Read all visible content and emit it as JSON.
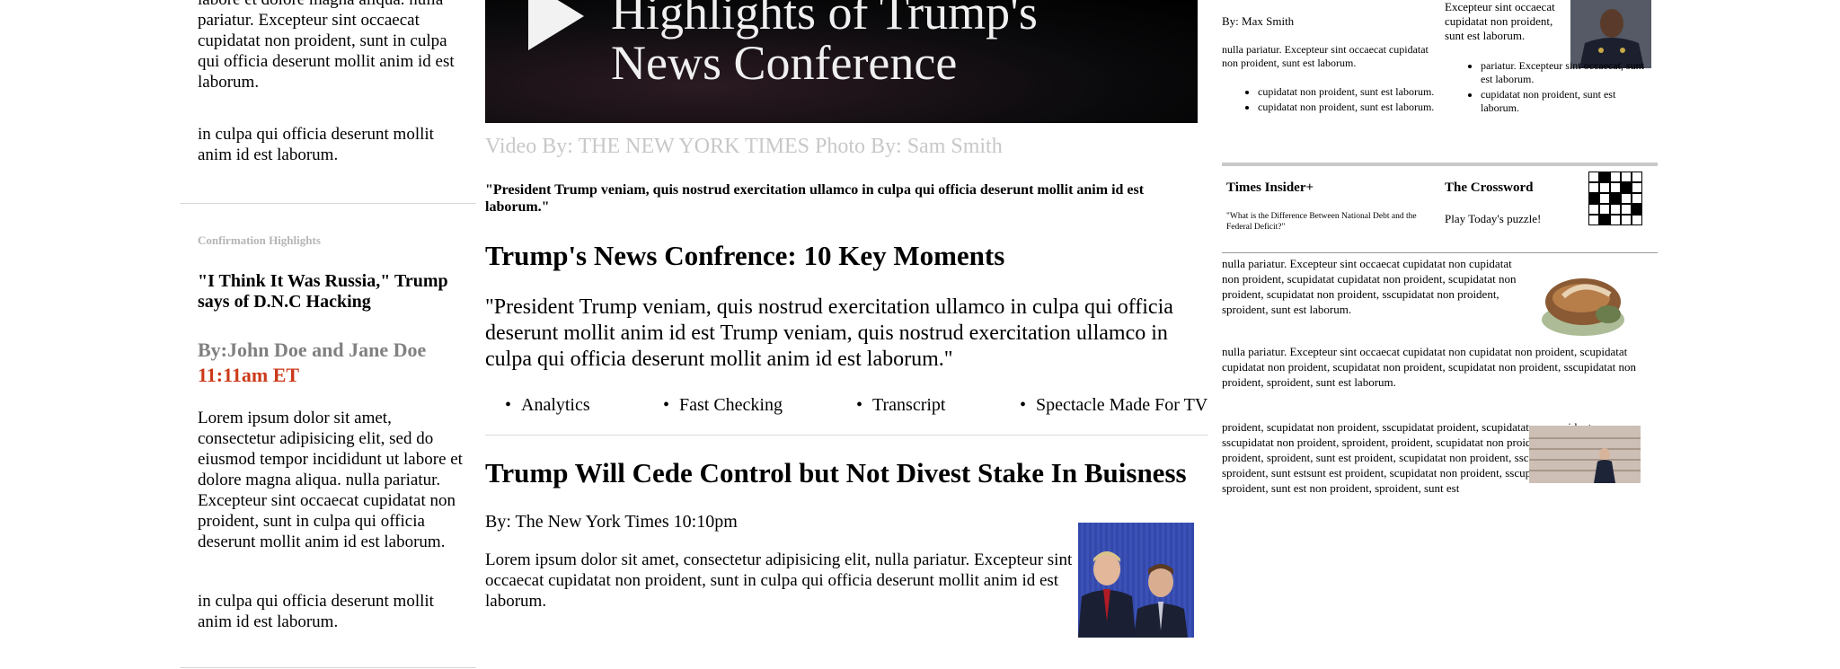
{
  "left": {
    "top_text": "labore et dolore magna aliqua. nulla pariatur. Excepteur sint occaecat cupidatat non proident, sunt in culpa qui officia deserunt mollit anim id est laborum.",
    "top_extra": "in culpa qui officia deserunt mollit anim id est laborum.",
    "section_label": "Confirmation Highlights",
    "headline": "\"I Think It Was Russia,\" Trump says of D.N.C Hacking",
    "byline": "By:John Doe and Jane Doe",
    "time": "11:11am ET",
    "body": "Lorem ipsum dolor sit amet, consectetur adipisicing elit, sed do eiusmod tempor incididunt ut labore et dolore magna aliqua. nulla pariatur. Excepteur sint occaecat cupidatat non proident, sunt in culpa qui officia deserunt mollit anim id est laborum.",
    "body2": "in culpa qui officia deserunt mollit anim id est laborum."
  },
  "center": {
    "video_title_line1": "Highlights of Trump's",
    "video_title_line2": "News Conference",
    "video_credit": "Video By: THE NEW YORK TIMES Photo By: Sam Smith",
    "quote_small": "\"President Trump veniam, quis nostrud exercitation ullamco in culpa qui officia deserunt mollit anim id est laborum.\"",
    "headline1": "Trump's News Confrence: 10 Key Moments",
    "quote_big": "\"President Trump veniam, quis nostrud exercitation ullamco in culpa qui officia deserunt mollit anim id est Trump veniam, quis nostrud exercitation ullamco in culpa qui officia deserunt mollit anim id est laborum.\"",
    "tabs": [
      "Analytics",
      "Fast Checking",
      "Transcript",
      "Spectacle Made For TV"
    ],
    "headline2": "Trump Will Cede Control but Not Divest Stake In Buisness",
    "byline2": "By: The New York Times 10:10pm",
    "lorem": "Lorem ipsum dolor sit amet, consectetur adipisicing elit, nulla pariatur. Excepteur sint occaecat cupidatat non proident, sunt in culpa qui officia deserunt mollit anim id est laborum."
  },
  "right": {
    "byline": "By: Max Smith",
    "p1": "nulla pariatur. Excepteur sint occaecat cupidatat non proident, sunt est laborum.",
    "list1": [
      "cupidatat non proident, sunt est laborum.",
      "cupidatat non proident, sunt est laborum."
    ],
    "col2_text": "Excepteur sint occaecat cupidatat non proident, sunt est laborum.",
    "list2": [
      "pariatur. Excepteur sint occaecat, sunt est laborum.",
      "cupidatat non proident, sunt est laborum."
    ],
    "insider_title": "Times Insider+",
    "insider_text": "\"What is the Difference Between National Debt and the Federal Deficit?\"",
    "crossword_title": "The Crossword",
    "crossword_text": "Play Today's puzzle!",
    "para1": "nulla pariatur. Excepteur sint occaecat cupidatat non cupidatat non proident, scupidatat cupidatat non proident, scupidatat non proident, scupidatat non proident, sscupidatat non proident, sproident, sunt est laborum.",
    "para2": "nulla pariatur. Excepteur sint occaecat cupidatat non cupidatat non proident, scupidatat cupidatat non proident, scupidatat non proident, scupidatat non proident, sscupidatat non proident, sproident, sunt est laborum.",
    "para3": "proident, scupidatat non proident, sscupidatat proident, scupidatat non proident, sscupidatat non proident, sproident, proident, scupidatat non proident, sscupidatat non proident, sproident, sunt est proident, scupidatat non proident, sscupidatat non proident, sproident, sunt estsunt est proident, scupidatat non proident, sscupidatat non proident, sproident, sunt est non proident, sproident, sunt est"
  }
}
